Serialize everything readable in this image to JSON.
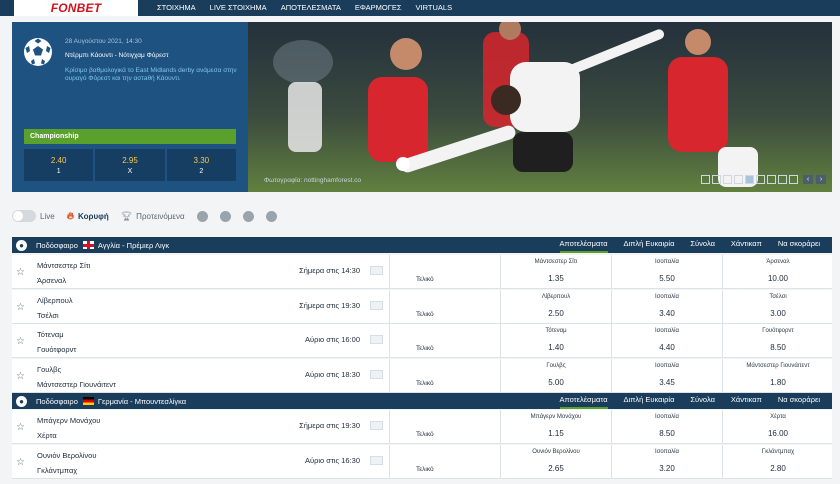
{
  "brand": {
    "logo": "FONBET"
  },
  "nav": [
    "ΣΤΟΙΧΗΜΑ",
    "LIVE ΣΤΟΙΧΗΜΑ",
    "ΑΠΟΤΕΛΕΣΜΑΤΑ",
    "ΕΦΑΡΜΟΓΕΣ",
    "VIRTUALS"
  ],
  "hero": {
    "date": "28 Αυγούστου 2021, 14:30",
    "title": "Ντέρμπι Κάουντι - Νότιγχαμ Φόρεστ",
    "description": "Κρίσιμο βαθμολογικά το East Midlands derby ανάμεσα στην ουραγό Φόρεστ και την αστaθή Κάουντι.",
    "league": "Championship",
    "odds": [
      {
        "value": "2.40",
        "label": "1"
      },
      {
        "value": "2.95",
        "label": "X"
      },
      {
        "value": "3.30",
        "label": "2"
      }
    ],
    "photo_credit": "Φωτογραφία: nottinghamforest.co",
    "slides_total": 9,
    "slide_active": 5
  },
  "filters": {
    "live": "Live",
    "top": "Κορυφή",
    "featured": "Προτεινόμενα",
    "sports": [
      "soccer-ball-icon",
      "basketball-icon",
      "tennis-ball-icon",
      "volleyball-icon"
    ]
  },
  "leagues": [
    {
      "sport": "Ποδόσφαιρο",
      "flag": "england-flag-icon",
      "name": "Αγγλία - Πρέμιερ Λιγκ",
      "tabs": [
        "Αποτελέσματα",
        "Διπλή Ευκαιρία",
        "Σύνολα",
        "Χάντικαπ",
        "Να σκοράρει"
      ],
      "matches": [
        {
          "home": "Μάντσεστερ Σίτι",
          "away": "Άρσεναλ",
          "time": "Σήμερα στις 14:30",
          "market": "Τελικό",
          "outcomes": [
            {
              "name": "Μάντσεστερ Σίτι",
              "odd": "1.35"
            },
            {
              "name": "Ισοπαλία",
              "odd": "5.50"
            },
            {
              "name": "Άρσεναλ",
              "odd": "10.00"
            }
          ]
        },
        {
          "home": "Λίβερπουλ",
          "away": "Τσέλσι",
          "time": "Σήμερα στις 19:30",
          "market": "Τελικό",
          "outcomes": [
            {
              "name": "Λίβερπουλ",
              "odd": "2.50"
            },
            {
              "name": "Ισοπαλία",
              "odd": "3.40"
            },
            {
              "name": "Τσέλσι",
              "odd": "3.00"
            }
          ]
        },
        {
          "home": "Τότεναμ",
          "away": "Γουότφορντ",
          "time": "Αύριο στις 16:00",
          "market": "Τελικό",
          "outcomes": [
            {
              "name": "Τότεναμ",
              "odd": "1.40"
            },
            {
              "name": "Ισοπαλία",
              "odd": "4.40"
            },
            {
              "name": "Γουότφορντ",
              "odd": "8.50"
            }
          ]
        },
        {
          "home": "Γουλβς",
          "away": "Μάντσεστερ Γιουνάιτεντ",
          "time": "Αύριο στις 18:30",
          "market": "Τελικό",
          "outcomes": [
            {
              "name": "Γουλβς",
              "odd": "5.00"
            },
            {
              "name": "Ισοπαλία",
              "odd": "3.45"
            },
            {
              "name": "Μάντσεστερ Γιουνάιτεντ",
              "odd": "1.80"
            }
          ]
        }
      ]
    },
    {
      "sport": "Ποδόσφαιρο",
      "flag": "germany-flag-icon",
      "name": "Γερμανία - Μπουντεσλίγκα",
      "tabs": [
        "Αποτελέσματα",
        "Διπλή Ευκαιρία",
        "Σύνολα",
        "Χάντικαπ",
        "Να σκοράρει"
      ],
      "matches": [
        {
          "home": "Μπάγερν Μονάχου",
          "away": "Χέρτα",
          "time": "Σήμερα στις 19:30",
          "market": "Τελικό",
          "outcomes": [
            {
              "name": "Μπάγερν Μονάχου",
              "odd": "1.15"
            },
            {
              "name": "Ισοπαλία",
              "odd": "8.50"
            },
            {
              "name": "Χέρτα",
              "odd": "16.00"
            }
          ]
        },
        {
          "home": "Ουνιόν Βερολίνου",
          "away": "Γκλάντμπαχ",
          "time": "Αύριο στις 16:30",
          "market": "Τελικό",
          "outcomes": [
            {
              "name": "Ουνιόν Βερολίνου",
              "odd": "2.65"
            },
            {
              "name": "Ισοπαλία",
              "odd": "3.20"
            },
            {
              "name": "Γκλάντμπαχ",
              "odd": "2.80"
            }
          ]
        }
      ]
    }
  ],
  "colors": {
    "navy": "#1a3d5c",
    "accent_red": "#d4121a",
    "accent_green": "#5aa02c",
    "odds_yellow": "#ffc83d"
  }
}
